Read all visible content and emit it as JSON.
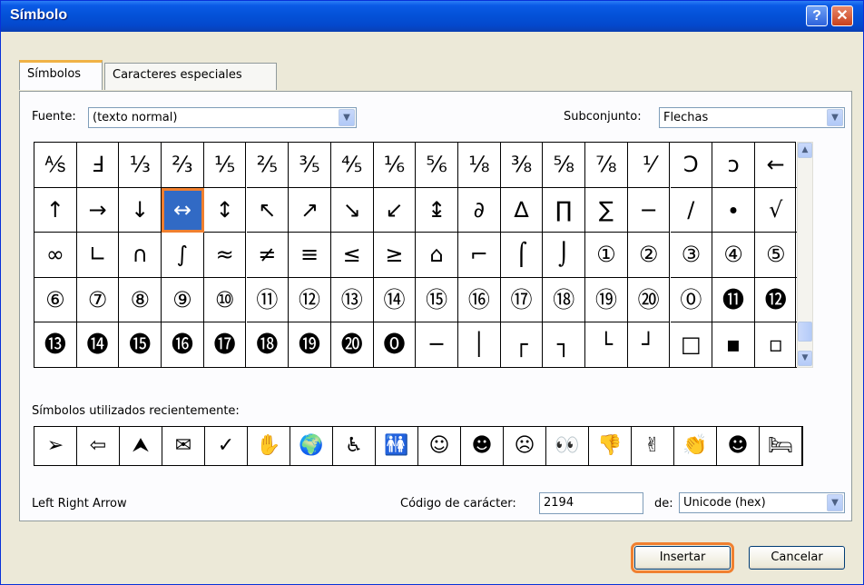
{
  "window": {
    "title": "Símbolo",
    "help_label": "?",
    "close_label": "✕"
  },
  "tabs": [
    {
      "label": "Símbolos",
      "active": true
    },
    {
      "label": "Caracteres especiales",
      "active": false
    }
  ],
  "font": {
    "label": "Fuente:",
    "value": "(texto normal)"
  },
  "subset": {
    "label": "Subconjunto:",
    "value": "Flechas"
  },
  "grid": {
    "selected_index": 21,
    "cells": [
      "⅍",
      "Ⅎ",
      "⅓",
      "⅔",
      "⅕",
      "⅖",
      "⅗",
      "⅘",
      "⅙",
      "⅚",
      "⅛",
      "⅜",
      "⅝",
      "⅞",
      "⅟",
      "Ↄ",
      "ↄ",
      "←",
      "↑",
      "→",
      "↓",
      "↔",
      "↕",
      "↖",
      "↗",
      "↘",
      "↙",
      "↨",
      "∂",
      "∆",
      "∏",
      "∑",
      "−",
      "∕",
      "∙",
      "√",
      "∞",
      "∟",
      "∩",
      "∫",
      "≈",
      "≠",
      "≡",
      "≤",
      "≥",
      "⌂",
      "⌐",
      "⌠",
      "⌡",
      "①",
      "②",
      "③",
      "④",
      "⑤",
      "⑥",
      "⑦",
      "⑧",
      "⑨",
      "⑩",
      "⑪",
      "⑫",
      "⑬",
      "⑭",
      "⑮",
      "⑯",
      "⑰",
      "⑱",
      "⑲",
      "⑳",
      "⓪",
      "⓫",
      "⓬",
      "⓭",
      "⓮",
      "⓯",
      "⓰",
      "⓱",
      "⓲",
      "⓳",
      "⓴",
      "⓿",
      "─",
      "│",
      "┌",
      "┐",
      "└",
      "┘",
      "□",
      "▪",
      "▫"
    ]
  },
  "recent": {
    "label": "Símbolos utilizados recientemente:",
    "items": [
      "➢",
      "⇦",
      "⮝",
      "✉",
      "✓",
      "✋",
      "🌍",
      "♿",
      "🚻",
      "☺",
      "☻",
      "☹",
      "👀",
      "👎",
      "✌",
      "👏",
      "☻",
      "🛏"
    ]
  },
  "char_name": "Left Right Arrow",
  "char_code": {
    "label": "Código de carácter:",
    "value": "2194"
  },
  "from": {
    "label": "de:",
    "value": "Unicode (hex)"
  },
  "buttons": {
    "insert": "Insertar",
    "cancel": "Cancelar"
  }
}
